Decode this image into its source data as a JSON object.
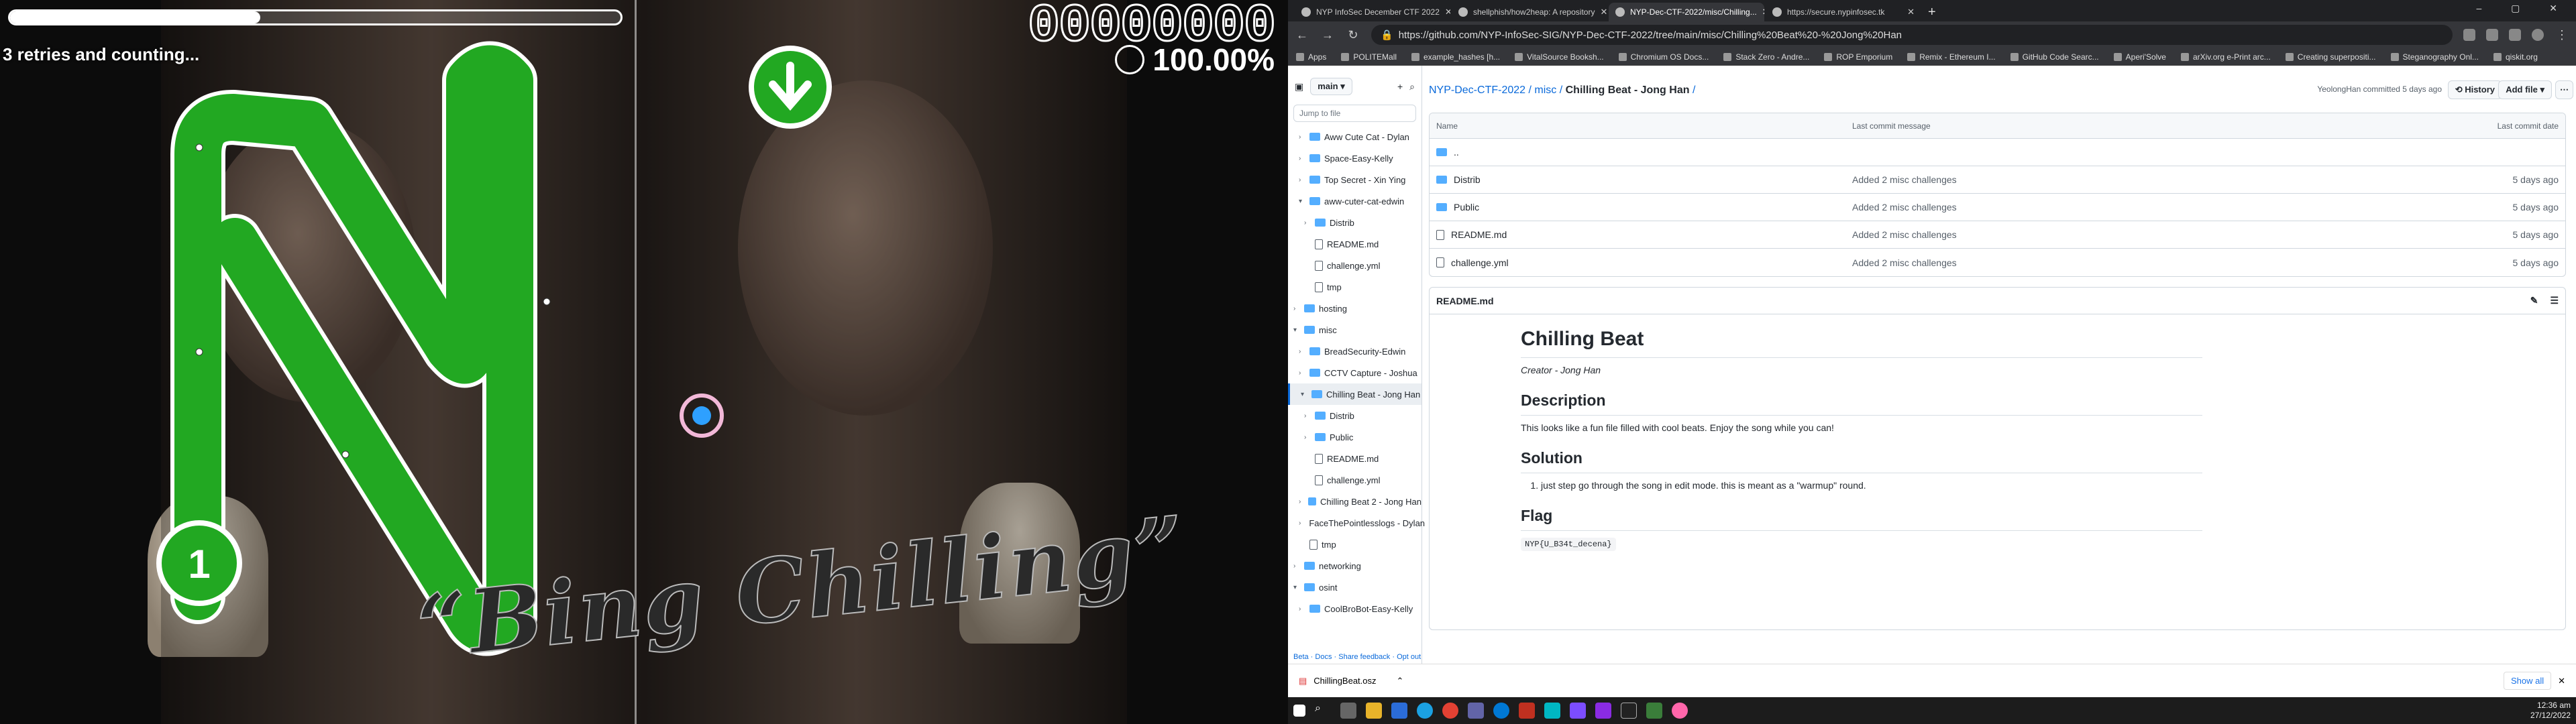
{
  "game": {
    "progress_fraction": 0.41,
    "retries_text": "3 retries and counting...",
    "score": "00000000",
    "accuracy": "100.00%",
    "lyric_text": "“Bing Chilling”",
    "combo_number": "1"
  },
  "browser": {
    "tabs": [
      {
        "label": "NYP InfoSec December CTF 2022"
      },
      {
        "label": "shellphish/how2heap: A repository"
      },
      {
        "label": "NYP-Dec-CTF-2022/misc/Chilling..."
      },
      {
        "label": "https://secure.nypinfosec.tk"
      }
    ],
    "url": "https://github.com/NYP-InfoSec-SIG/NYP-Dec-CTF-2022/tree/main/misc/Chilling%20Beat%20-%20Jong%20Han",
    "bookmarks": [
      "Apps",
      "POLITEMall",
      "example_hashes [h...",
      "VitalSource Booksh...",
      "Chromium OS Docs...",
      "Stack Zero - Andre...",
      "ROP Emporium",
      "Remix - Ethereum I...",
      "GitHub Code Searc...",
      "Aperi'Solve",
      "arXiv.org e-Print arc...",
      "Creating superpositi...",
      "Steganography Onl...",
      "qiskit.org"
    ]
  },
  "github": {
    "branch": "main",
    "jump_placeholder": "Jump to file",
    "tree": [
      {
        "label": "Aww Cute Cat - Dylan",
        "type": "folder",
        "depth": 1,
        "expanded": false
      },
      {
        "label": "Space-Easy-Kelly",
        "type": "folder",
        "depth": 1,
        "expanded": false
      },
      {
        "label": "Top Secret - Xin Ying",
        "type": "folder",
        "depth": 1,
        "expanded": false
      },
      {
        "label": "aww-cuter-cat-edwin",
        "type": "folder",
        "depth": 1,
        "expanded": true
      },
      {
        "label": "Distrib",
        "type": "folder",
        "depth": 2,
        "expanded": false
      },
      {
        "label": "README.md",
        "type": "file",
        "depth": 2
      },
      {
        "label": "challenge.yml",
        "type": "file",
        "depth": 2
      },
      {
        "label": "tmp",
        "type": "file",
        "depth": 2
      },
      {
        "label": "hosting",
        "type": "folder",
        "depth": 0,
        "expanded": false
      },
      {
        "label": "misc",
        "type": "folder",
        "depth": 0,
        "expanded": true
      },
      {
        "label": "BreadSecurity-Edwin",
        "type": "folder",
        "depth": 1,
        "expanded": false
      },
      {
        "label": "CCTV Capture - Joshua",
        "type": "folder",
        "depth": 1,
        "expanded": false
      },
      {
        "label": "Chilling Beat - Jong Han",
        "type": "folder",
        "depth": 1,
        "expanded": true,
        "selected": true
      },
      {
        "label": "Distrib",
        "type": "folder",
        "depth": 2,
        "expanded": false
      },
      {
        "label": "Public",
        "type": "folder",
        "depth": 2,
        "expanded": false
      },
      {
        "label": "README.md",
        "type": "file",
        "depth": 2
      },
      {
        "label": "challenge.yml",
        "type": "file",
        "depth": 2
      },
      {
        "label": "Chilling Beat 2 - Jong Han",
        "type": "folder",
        "depth": 1,
        "expanded": false
      },
      {
        "label": "FaceThePointlesslogs - Dylan",
        "type": "folder",
        "depth": 1,
        "expanded": false
      },
      {
        "label": "tmp",
        "type": "file",
        "depth": 1
      },
      {
        "label": "networking",
        "type": "folder",
        "depth": 0,
        "expanded": false
      },
      {
        "label": "osint",
        "type": "folder",
        "depth": 0,
        "expanded": true
      },
      {
        "label": "CoolBroBot-Easy-Kelly",
        "type": "folder",
        "depth": 1,
        "expanded": false
      }
    ],
    "beta_text": "Beta · Docs · Share feedback · Opt out",
    "breadcrumb": {
      "repo": "NYP-Dec-CTF-2022",
      "sep1": " / ",
      "dir": "misc",
      "sep2": " / ",
      "current": "Chilling Beat - Jong Han",
      "sep3": " /"
    },
    "commit_info": "YeolongHan  committed 5 days ago",
    "history_label": "History",
    "add_file_label": "Add file",
    "table_headers": {
      "name": "Name",
      "message": "Last commit message",
      "date": "Last commit date"
    },
    "files": [
      {
        "name": "..",
        "type": "folder",
        "message": "",
        "date": ""
      },
      {
        "name": "Distrib",
        "type": "folder",
        "message": "Added 2 misc challenges",
        "date": "5 days ago"
      },
      {
        "name": "Public",
        "type": "folder",
        "message": "Added 2 misc challenges",
        "date": "5 days ago"
      },
      {
        "name": "README.md",
        "type": "file",
        "message": "Added 2 misc challenges",
        "date": "5 days ago"
      },
      {
        "name": "challenge.yml",
        "type": "file",
        "message": "Added 2 misc challenges",
        "date": "5 days ago"
      }
    ],
    "readme": {
      "filename": "README.md",
      "title": "Chilling Beat",
      "creator": "Creator - Jong Han",
      "h_description": "Description",
      "description": "This looks like a fun file filled with cool beats. Enjoy the song while you can!",
      "h_solution": "Solution",
      "solution_item": "just step go through the song in edit mode. this is meant as a \"warmup\" round.",
      "h_flag": "Flag",
      "flag": "NYP{U_B34t_decena}"
    }
  },
  "download": {
    "filename": "ChillingBeat.osz",
    "show_all": "Show all"
  },
  "taskbar": {
    "time": "12:36 am",
    "date": "27/12/2022"
  }
}
